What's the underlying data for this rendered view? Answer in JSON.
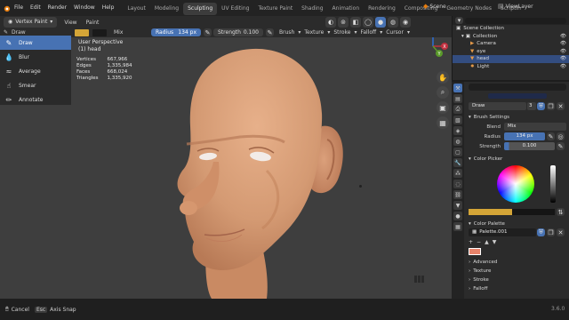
{
  "topbar": {
    "menus": [
      "File",
      "Edit",
      "Render",
      "Window",
      "Help"
    ],
    "workspaces": [
      "Layout",
      "Modeling",
      "Sculpting",
      "UV Editing",
      "Texture Paint",
      "Shading",
      "Animation",
      "Rendering",
      "Compositing",
      "Geometry Nodes",
      "Scriptin"
    ],
    "active_workspace": "Sculpting",
    "scene_label": "Scene",
    "viewlayer_label": "ViewLayer"
  },
  "header": {
    "mode": "Vertex Paint",
    "view": "View",
    "paint": "Paint",
    "brush_name": "Draw",
    "blend": "Mix",
    "radius_label": "Radius",
    "radius_value": "134 px",
    "strength_label": "Strength",
    "strength_value": "0.100",
    "brush_menu": "Brush",
    "texture_menu": "Texture",
    "stroke_menu": "Stroke",
    "falloff_menu": "Falloff",
    "cursor_menu": "Cursor",
    "brush_color": "#d4a537"
  },
  "tools": [
    {
      "label": "Draw",
      "icon": "brush-icon"
    },
    {
      "label": "Blur",
      "icon": "drop-icon"
    },
    {
      "label": "Average",
      "icon": "average-icon"
    },
    {
      "label": "Smear",
      "icon": "smear-icon"
    },
    {
      "label": "Annotate",
      "icon": "pencil-icon"
    }
  ],
  "viewport": {
    "perspective": "User Perspective",
    "object": "(1) head",
    "stats": [
      {
        "label": "Vertices",
        "value": "667,966"
      },
      {
        "label": "Edges",
        "value": "1,335,984"
      },
      {
        "label": "Faces",
        "value": "668,024"
      },
      {
        "label": "Triangles",
        "value": "1,335,920"
      }
    ],
    "axis_z": "Z",
    "axis_y": "Y",
    "axis_x": "X",
    "background": "#3e3e3e",
    "skin_color": "#d9a07a"
  },
  "outliner": {
    "items": [
      {
        "label": "Scene Collection",
        "depth": 0
      },
      {
        "label": "Collection",
        "depth": 1
      },
      {
        "label": "Camera",
        "depth": 2
      },
      {
        "label": "eye",
        "depth": 2
      },
      {
        "label": "head",
        "depth": 2,
        "selected": true
      },
      {
        "label": "Light",
        "depth": 2
      }
    ]
  },
  "properties": {
    "brush_slot": "Draw",
    "brush_users": "3",
    "brush_settings_title": "Brush Settings",
    "blend_label": "Blend",
    "blend_value": "Mix",
    "radius_label": "Radius",
    "radius_value": "134 px",
    "strength_label": "Strength",
    "strength_value": "0.100",
    "color_picker_title": "Color Picker",
    "color_palette_title": "Color Palette",
    "palette_name": "Palette.001",
    "swatch_color": "#e8836a",
    "collapsed_sections": [
      "Advanced",
      "Texture",
      "Stroke",
      "Falloff"
    ]
  },
  "status": {
    "cancel": "Cancel",
    "esc": "Esc",
    "axis_snap": "Axis Snap",
    "version": "3.6.0"
  }
}
